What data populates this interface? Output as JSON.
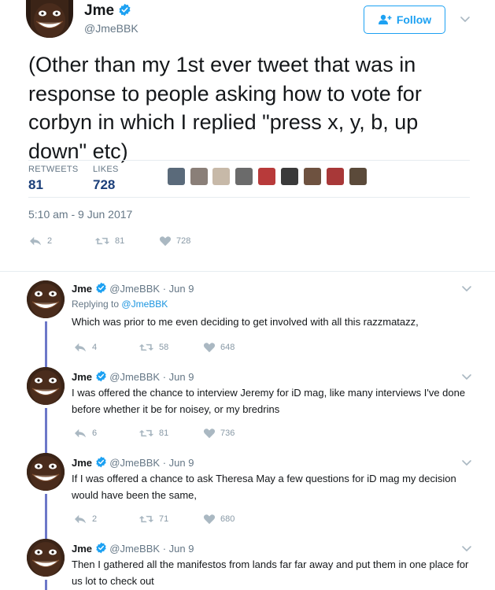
{
  "main": {
    "name": "Jme",
    "handle": "@JmeBBK",
    "follow_label": "Follow",
    "text": "(Other than my 1st ever tweet that was in response to people asking how to vote for corbyn in which I replied \"press x, y, b, up down\" etc)",
    "retweets_label": "RETWEETS",
    "retweets": "81",
    "likes_label": "LIKES",
    "likes": "728",
    "timestamp": "5:10 am - 9 Jun 2017",
    "reply_count": "2",
    "retweet_count": "81",
    "like_count": "728"
  },
  "replies": [
    {
      "name": "Jme",
      "handle": "@JmeBBK",
      "date": "· Jun 9",
      "replying_prefix": "Replying to",
      "replying_to": "@JmeBBK",
      "text": "Which was prior to me even deciding to get involved with all this razzmatazz,",
      "reply_count": "4",
      "retweet_count": "58",
      "like_count": "648"
    },
    {
      "name": "Jme",
      "handle": "@JmeBBK",
      "date": "· Jun 9",
      "text": "I was offered the chance to interview Jeremy for iD mag, like many interviews I've done before whether it be for noisey, or my bredrins",
      "reply_count": "6",
      "retweet_count": "81",
      "like_count": "736"
    },
    {
      "name": "Jme",
      "handle": "@JmeBBK",
      "date": "· Jun 9",
      "text": "If I was offered a chance to ask Theresa May a few questions for iD mag my decision would have been the same,",
      "reply_count": "2",
      "retweet_count": "71",
      "like_count": "680"
    },
    {
      "name": "Jme",
      "handle": "@JmeBBK",
      "date": "· Jun 9",
      "text": "Then I gathered all the manifestos from lands far far away and put them in one place for us lot to check out"
    }
  ],
  "colors": {
    "accent": "#1da1f2",
    "thread_line": "#6d78c8",
    "stat_value": "#1b3f7a",
    "muted": "#657786"
  },
  "icons": [
    "verified-icon",
    "follow-person-icon",
    "chevron-down-icon",
    "reply-icon",
    "retweet-icon",
    "heart-icon"
  ]
}
